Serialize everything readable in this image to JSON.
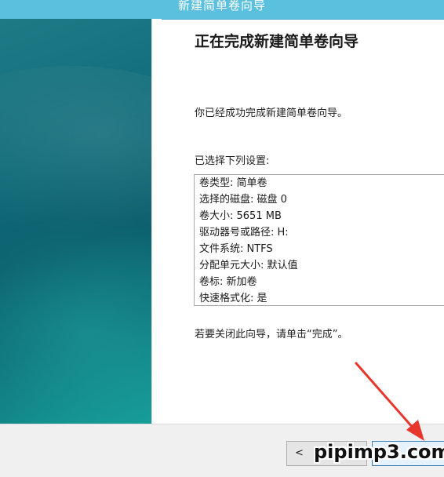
{
  "window": {
    "title": "新建简单卷向导"
  },
  "page": {
    "heading": "正在完成新建简单卷向导",
    "intro": "你已经成功完成新建简单卷向导。",
    "settings_label": "已选择下列设置:",
    "settings": [
      "卷类型: 简单卷",
      "选择的磁盘: 磁盘 0",
      "卷大小: 5651 MB",
      "驱动器号或路径: H:",
      "文件系统: NTFS",
      "分配单元大小: 默认值",
      "卷标: 新加卷",
      "快速格式化: 是"
    ],
    "closing": "若要关闭此向导，请单击“完成”。"
  },
  "buttons": {
    "back_label": "<"
  },
  "watermark": "pipimp3.com",
  "colors": {
    "accent_titlebar": "#5bc0de",
    "side_panel": "#0f6a78",
    "arrow": "#e8362d"
  }
}
